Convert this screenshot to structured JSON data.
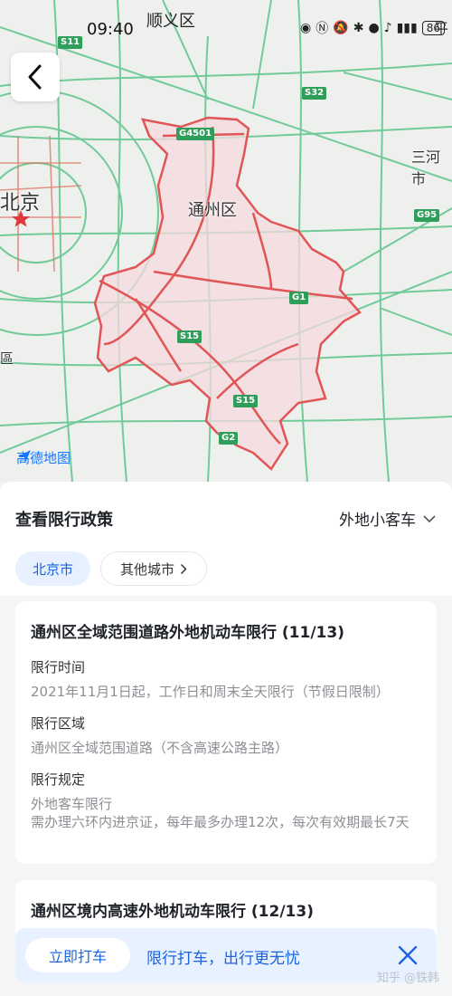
{
  "status_bar": {
    "time": "09:40",
    "district": "顺义区",
    "battery": "86"
  },
  "map": {
    "labels": {
      "beijing": "北京",
      "tongzhou": "通州区",
      "sanhe": "三河市",
      "ping": "平",
      "edge_left": "區"
    },
    "shields": {
      "s11": "S11",
      "s32": "S32",
      "g4501": "G4501",
      "g95": "G95",
      "g1": "G1",
      "s15a": "S15",
      "s15b": "S15",
      "g2": "G2"
    },
    "logo": "高德地图",
    "colors": {
      "boundary": "#e05555",
      "fill": "#f6d9dd",
      "road": "#39b36b"
    }
  },
  "policy": {
    "title": "查看限行政策",
    "vehicle_type": "外地小客车"
  },
  "city_tabs": {
    "active": "北京市",
    "other": "其他城市"
  },
  "card1": {
    "title": "通州区全域范围道路外地机动车限行 (11/13)",
    "time_label": "限行时间",
    "time_value": "2021年11月1日起，工作日和周末全天限行（节假日限制）",
    "area_label": "限行区域",
    "area_value": "通州区全域范围道路（不含高速公路主路）",
    "rule_label": "限行规定",
    "rule_value_1": "外地客车限行",
    "rule_value_2": "需办理六环内进京证，每年最多办理12次，每次有效期最长7天"
  },
  "card2": {
    "title": "通州区境内高速外地机动车限行 (12/13)"
  },
  "promo": {
    "button": "立即打车",
    "text": "限行打车，出行更无忧"
  },
  "watermark": "知乎 @铁韩"
}
